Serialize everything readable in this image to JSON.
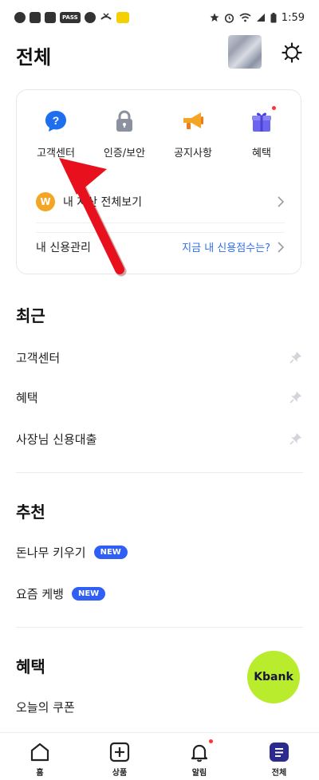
{
  "status_bar": {
    "time": "1:59",
    "pass_label": "PASS"
  },
  "header": {
    "title": "전체"
  },
  "quick_menu": [
    {
      "label": "고객센터",
      "icon": "question-bubble-icon",
      "color": "#1e6ff0"
    },
    {
      "label": "인증/보안",
      "icon": "lock-icon",
      "color": "#8c91a0"
    },
    {
      "label": "공지사항",
      "icon": "megaphone-icon",
      "color": "#f5a524"
    },
    {
      "label": "혜택",
      "icon": "gift-icon",
      "color": "#6b64f0"
    }
  ],
  "assets_row": {
    "label": "내 자산 전체보기",
    "icon_text": "W"
  },
  "credit_row": {
    "label": "내 신용관리",
    "link": "지금 내 신용점수는?"
  },
  "recent": {
    "title": "최근",
    "items": [
      {
        "label": "고객센터"
      },
      {
        "label": "혜택"
      },
      {
        "label": "사장님 신용대출"
      }
    ]
  },
  "recommend": {
    "title": "추천",
    "items": [
      {
        "label": "돈나무 키우기",
        "badge": "NEW"
      },
      {
        "label": "요즘 케뱅",
        "badge": "NEW"
      }
    ]
  },
  "benefits": {
    "title": "혜택",
    "items": [
      {
        "label": "오늘의 쿠폰"
      }
    ]
  },
  "fab": {
    "label": "Kbank",
    "color": "#b9ec2d"
  },
  "bottom_nav": [
    {
      "label": "홈"
    },
    {
      "label": "상품"
    },
    {
      "label": "알림"
    },
    {
      "label": "전체"
    }
  ],
  "colors": {
    "accent_blue": "#2f5ff5",
    "link_blue": "#2f6ef5",
    "arrow_red": "#e8101c",
    "nav_active": "#2c2a8c"
  }
}
